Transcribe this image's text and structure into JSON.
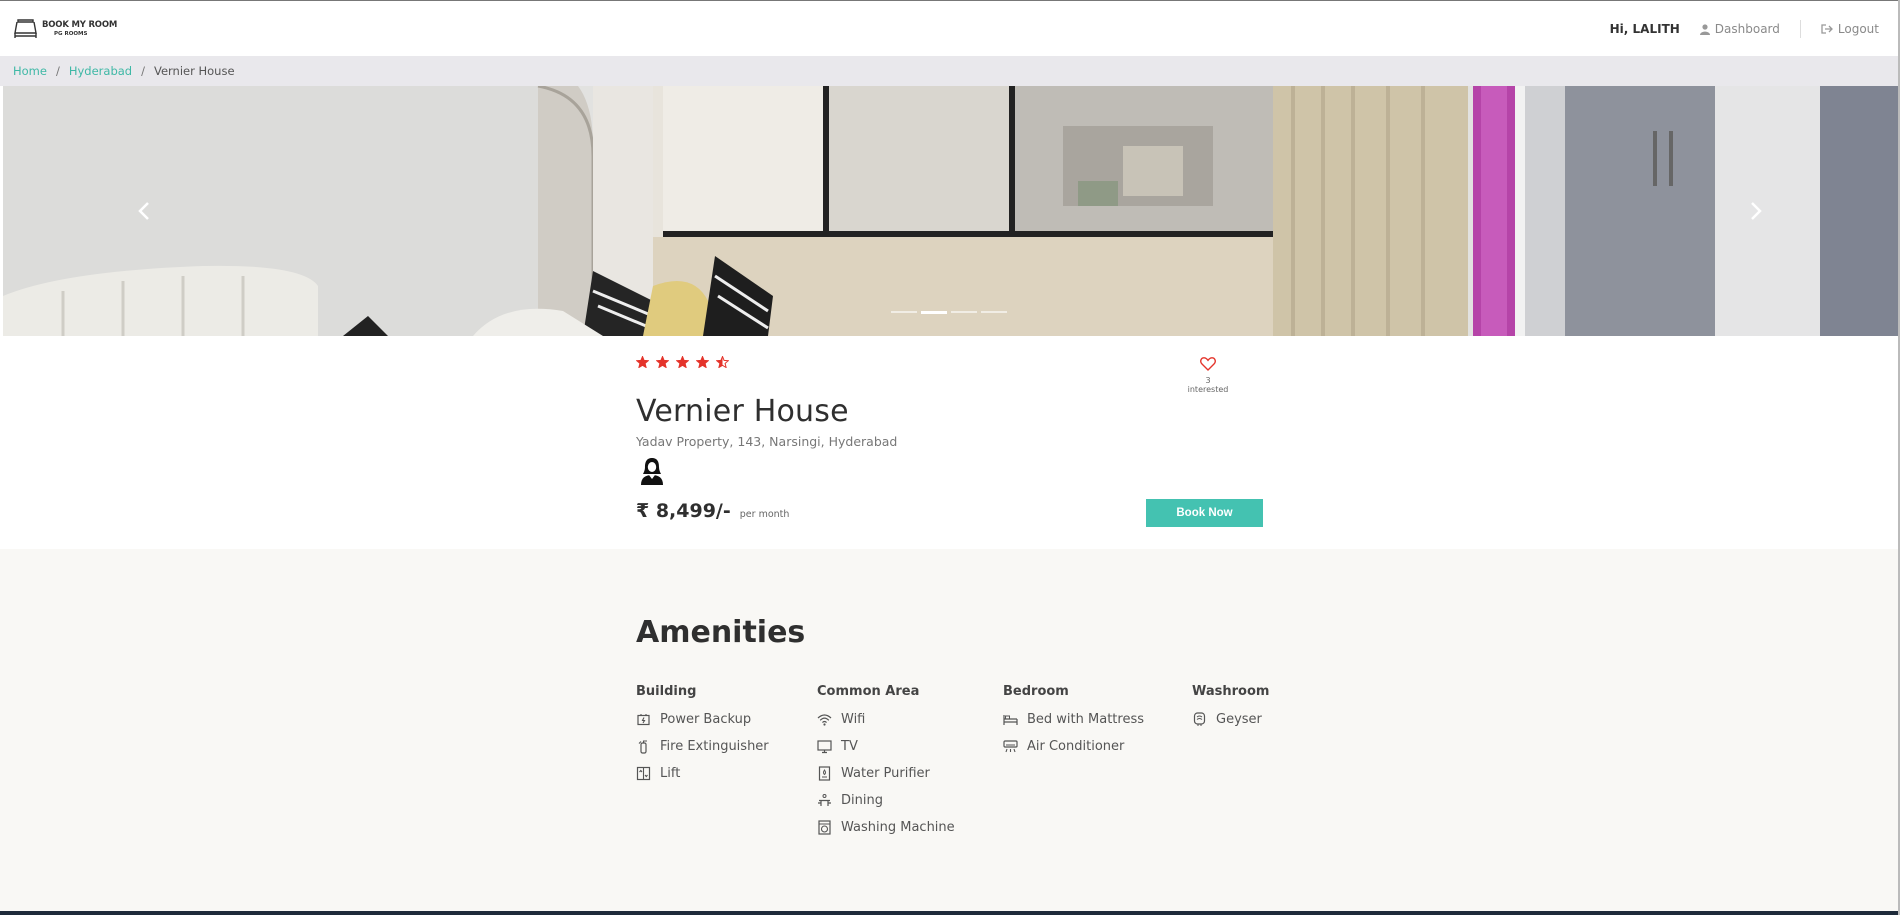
{
  "brand": {
    "line1": "BOOK MY ROOM",
    "line2": "PG ROOMS"
  },
  "nav": {
    "greeting": "Hi, LALITH",
    "dashboard": "Dashboard",
    "logout": "Logout"
  },
  "breadcrumb": {
    "home": "Home",
    "city": "Hyderabad",
    "current": "Vernier House"
  },
  "carousel": {
    "slides": 4,
    "active_index": 1
  },
  "property": {
    "rating": 4.5,
    "interested": "3 interested",
    "name": "Vernier House",
    "address": "Yadav Property, 143, Narsingi, Hyderabad",
    "gender_icon": "female-icon",
    "price": "₹ 8,499/-",
    "price_unit": "per month",
    "book_label": "Book Now"
  },
  "amenities": {
    "title": "Amenities",
    "groups": [
      {
        "name": "Building",
        "items": [
          {
            "label": "Power Backup",
            "icon": "power-backup-icon"
          },
          {
            "label": "Fire Extinguisher",
            "icon": "fire-extinguisher-icon"
          },
          {
            "label": "Lift",
            "icon": "lift-icon"
          }
        ]
      },
      {
        "name": "Common Area",
        "items": [
          {
            "label": "Wifi",
            "icon": "wifi-icon"
          },
          {
            "label": "TV",
            "icon": "tv-icon"
          },
          {
            "label": "Water Purifier",
            "icon": "water-purifier-icon"
          },
          {
            "label": "Dining",
            "icon": "dining-icon"
          },
          {
            "label": "Washing Machine",
            "icon": "washing-machine-icon"
          }
        ]
      },
      {
        "name": "Bedroom",
        "items": [
          {
            "label": "Bed with Mattress",
            "icon": "bed-icon"
          },
          {
            "label": "Air Conditioner",
            "icon": "air-conditioner-icon"
          }
        ]
      },
      {
        "name": "Washroom",
        "items": [
          {
            "label": "Geyser",
            "icon": "geyser-icon"
          }
        ]
      }
    ]
  },
  "colors": {
    "accent": "#44c2b1",
    "link": "#3fb8a6",
    "star": "#e4342b",
    "breadcrumb_bg": "#e9e8ec",
    "amenities_bg": "#f9f8f5"
  }
}
